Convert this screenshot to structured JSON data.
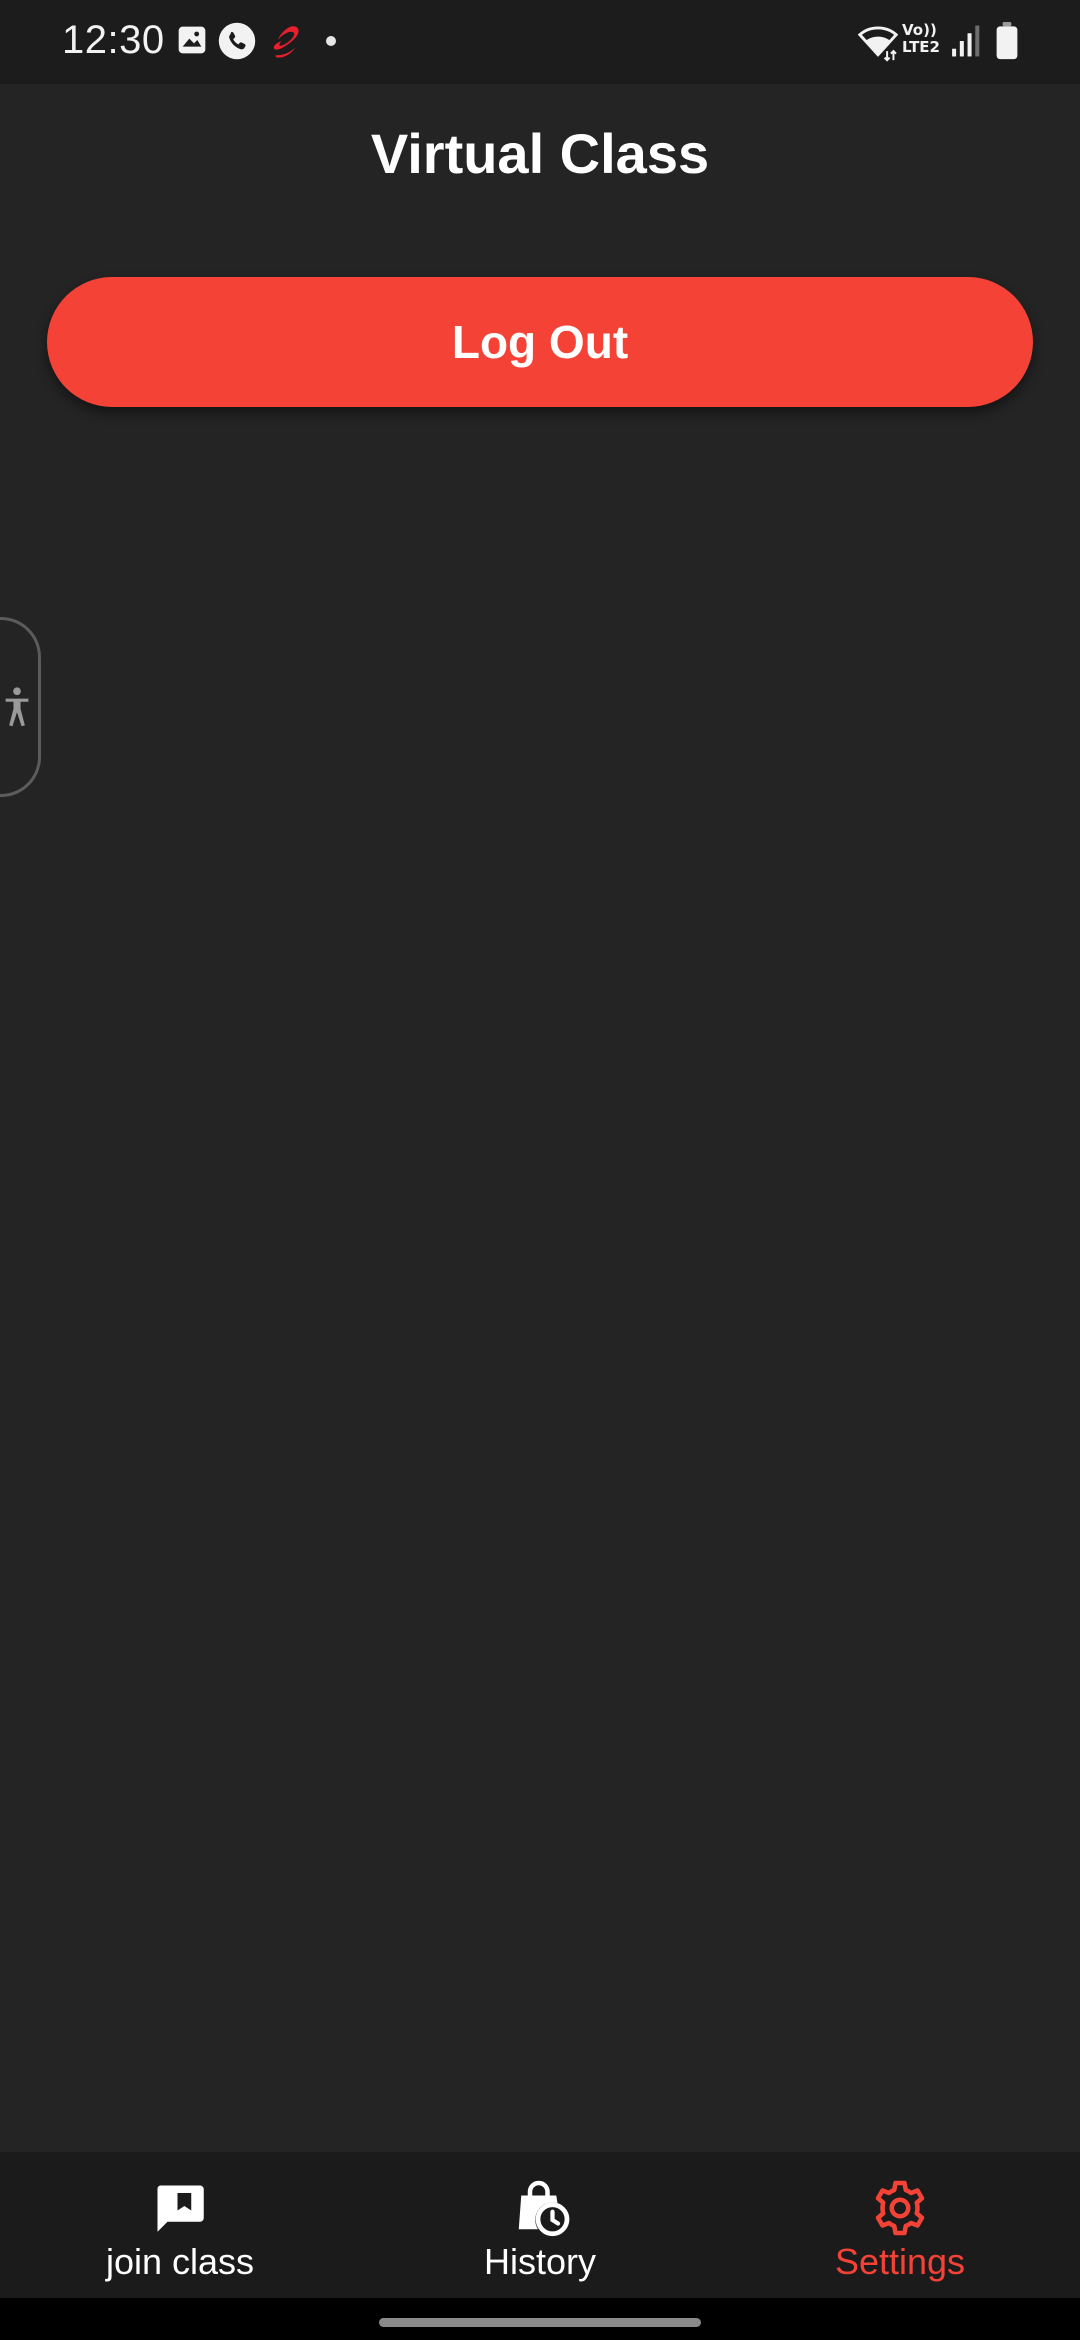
{
  "status_bar": {
    "time": "12:30",
    "network_label_top": "Vo))",
    "network_label_bottom": "LTE2",
    "icons": [
      "gallery-icon",
      "phone-call-icon",
      "airtel-icon",
      "notification-dot",
      "wifi-icon",
      "signal-icon",
      "battery-icon"
    ]
  },
  "header": {
    "title": "Virtual Class"
  },
  "actions": {
    "logout_label": "Log Out",
    "accent_color": "#f44336"
  },
  "side_tab": {
    "icon": "accessibility-icon"
  },
  "bottom_nav": {
    "items": [
      {
        "label": "join class",
        "icon": "chat-bookmark-icon",
        "active": false
      },
      {
        "label": "History",
        "icon": "history-bag-icon",
        "active": false
      },
      {
        "label": "Settings",
        "icon": "gear-icon",
        "active": true
      }
    ]
  },
  "colors": {
    "background": "#242424",
    "nav_background": "#1b1b1b",
    "active": "#f44336",
    "text": "#ffffff"
  }
}
